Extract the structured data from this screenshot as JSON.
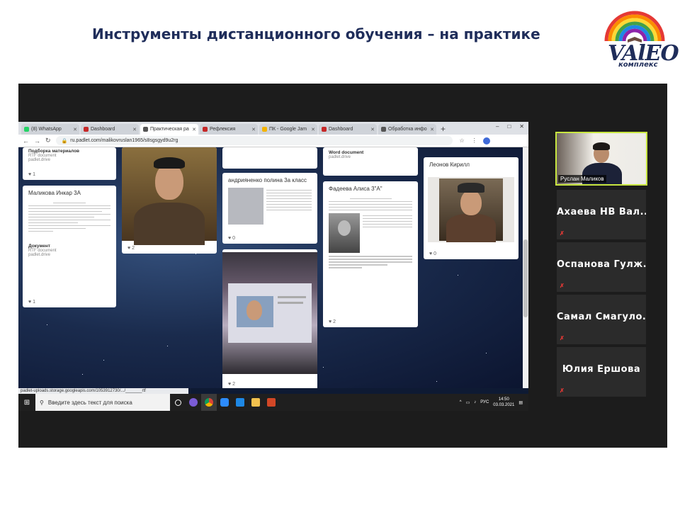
{
  "slide": {
    "title": "Инструменты дистанционного обучения – на практике",
    "logo_text": "VAlEO",
    "logo_sub": "комплекс"
  },
  "browser": {
    "tabs": [
      {
        "label": "(8) WhatsApp",
        "color": "#25d366"
      },
      {
        "label": "Dashboard",
        "color": "#c62828"
      },
      {
        "label": "Практическая ра",
        "color": "#555555",
        "active": true
      },
      {
        "label": "Рефлексия",
        "color": "#c62828"
      },
      {
        "label": "ПК - Google Jam",
        "color": "#f4b400"
      },
      {
        "label": "Dashboard",
        "color": "#c62828"
      },
      {
        "label": "Обработка инфо",
        "color": "#555555"
      }
    ],
    "url": "ru.padlet.com/malikovruslan1965/s8sgsgyd9u2rg",
    "status_url": "padlet-uploads.storage.googleapis.com/1053912730/.../_______rtf"
  },
  "padlet": {
    "cards": {
      "c1": {
        "title": "Подборка материалов",
        "type": "RTF document",
        "src": "padlet.drive",
        "likes": "1"
      },
      "c2": {
        "title": "Маликова Инкар 3А",
        "doc_label": "Документ",
        "type": "RTF document",
        "src": "padlet.drive",
        "likes": "1"
      },
      "c3": {
        "likes": "2"
      },
      "c4": {
        "title": "андрияненко полина 3а класс",
        "likes": "0"
      },
      "c5": {
        "likes": "2"
      },
      "c6": {
        "title": "Word document",
        "src": "padlet.drive"
      },
      "c7": {
        "title": "Фадеева Алиса 3\"А\"",
        "likes": "2"
      },
      "c8": {
        "title": "Леонов Кирилл",
        "likes": "0"
      }
    },
    "fab_label": "+"
  },
  "taskbar": {
    "search_placeholder": "Введите здесь текст для поиска",
    "lang": "РУС",
    "time": "14:50",
    "date": "03.03.2021"
  },
  "participants": {
    "self_name": "Руслан Маликов",
    "others": [
      "Ахаева НВ Вал...",
      "Оспанова Гулж...",
      "Самал Смагуло...",
      "Юлия Ершова"
    ]
  }
}
